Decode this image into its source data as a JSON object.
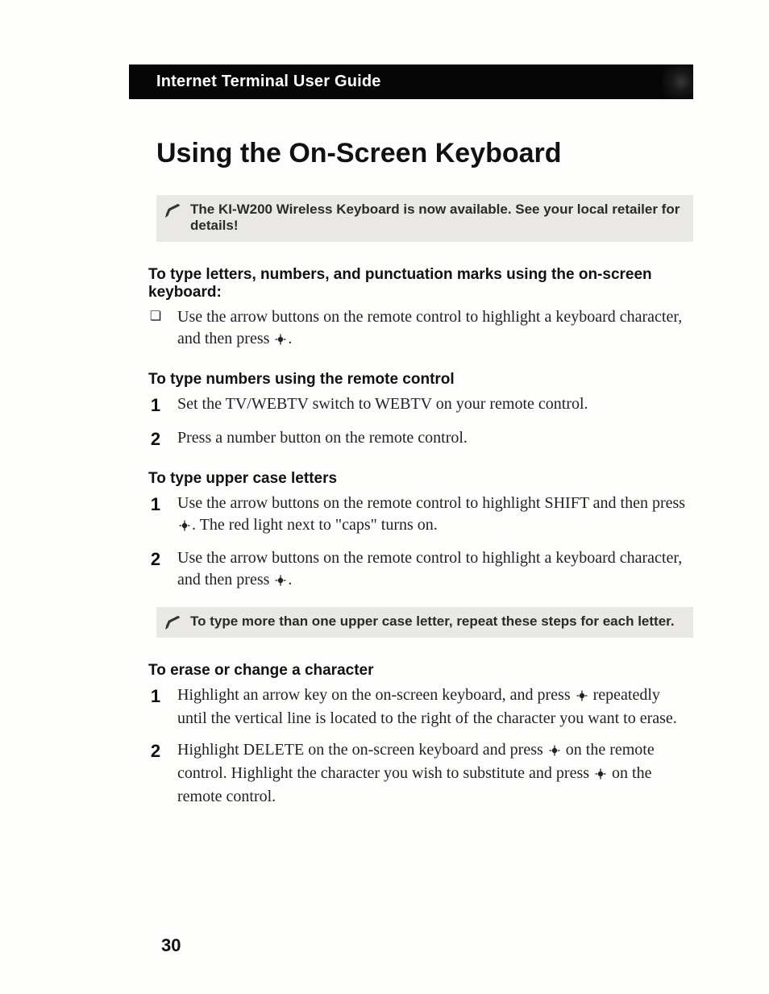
{
  "header": {
    "title": "Internet Terminal User Guide"
  },
  "main_title": "Using the On-Screen Keyboard",
  "note1": "The KI-W200 Wireless Keyboard is now available. See your local retailer for details!",
  "sections": {
    "s1": {
      "heading": "To type letters, numbers, and punctuation marks using the on-screen keyboard:",
      "bullet1a": "Use the arrow buttons on the remote control to highlight a keyboard character, and then press ",
      "bullet1b": "."
    },
    "s2": {
      "heading": "To type numbers using the remote control",
      "step1": "Set the TV/WEBTV switch to WEBTV on your remote control.",
      "step2": "Press a number button on the remote control."
    },
    "s3": {
      "heading": "To type upper case letters",
      "step1a": "Use the arrow buttons on the remote control to highlight SHIFT and then press ",
      "step1b": ". The red light next to \"caps\" turns on.",
      "step2a": "Use the arrow buttons on the remote control to highlight a keyboard character, and then press ",
      "step2b": "."
    },
    "note2": "To type more than one upper case letter, repeat these steps for each letter.",
    "s4": {
      "heading": "To erase or change a character",
      "step1a": "Highlight an arrow key on the on-screen keyboard, and press ",
      "step1b": " repeatedly until the vertical line is located to the right of the character you want to erase.",
      "step2a": "Highlight DELETE on the on-screen keyboard and press ",
      "step2b": " on the remote control. Highlight the character you wish to substitute and press ",
      "step2c": " on the remote control."
    }
  },
  "page_number": "30"
}
